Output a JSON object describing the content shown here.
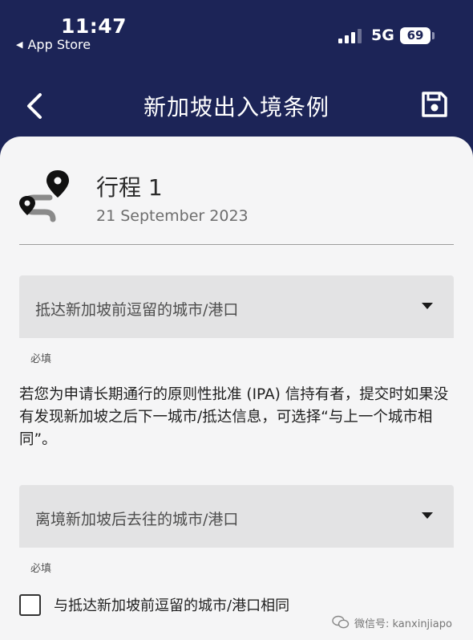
{
  "status_bar": {
    "time": "11:47",
    "back_app": "App Store",
    "network": "5G",
    "battery": "69"
  },
  "nav": {
    "title": "新加坡出入境条例"
  },
  "trip": {
    "title": "行程 1",
    "date": "21 September 2023"
  },
  "arrival_city": {
    "placeholder": "抵达新加坡前逗留的城市/港口",
    "helper": "必填"
  },
  "info_text": "若您为申请长期通行的原则性批准 (IPA) 信持有者，提交时如果没有发现新加坡之后下一城市/抵达信息，可选择“与上一个城市相同”。",
  "departure_city": {
    "placeholder": "离境新加坡后去往的城市/港口",
    "helper": "必填"
  },
  "same_city_checkbox": {
    "label": "与抵达新加坡前逗留的城市/港口相同",
    "checked": false
  },
  "watermark": {
    "text": "微信号: kanxinjiapo"
  },
  "colors": {
    "header_bg": "#1c2457",
    "content_bg": "#f5f5f6",
    "field_bg": "#e3e3e4"
  }
}
